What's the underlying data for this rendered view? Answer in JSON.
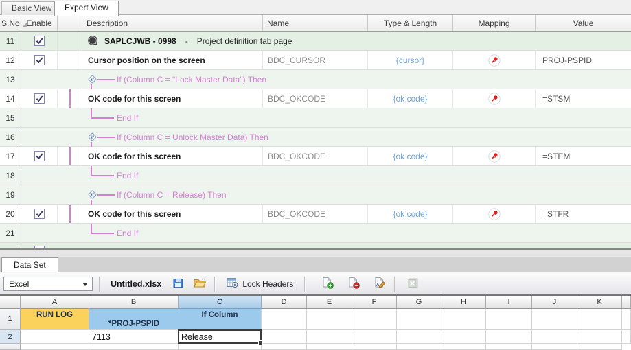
{
  "view_tabs": [
    {
      "label": "Basic View",
      "active": false
    },
    {
      "label": "Expert View",
      "active": true
    }
  ],
  "script_table": {
    "headers": [
      "S.No",
      "Enable",
      "",
      "Description",
      "Name",
      "Type & Length",
      "Mapping",
      "Value"
    ],
    "rows": [
      {
        "sno": "11",
        "kind": "screen",
        "enabled": true,
        "program": "SAPLCJWB - 0998",
        "separator": "-",
        "description": "Project definition tab page"
      },
      {
        "sno": "12",
        "kind": "field",
        "enabled": true,
        "in_branch": false,
        "description": "Cursor position on the screen",
        "name": "BDC_CURSOR",
        "type_length": "{cursor}",
        "mapping": "mapped",
        "value": "PROJ-PSPID"
      },
      {
        "sno": "13",
        "kind": "if",
        "text": "If (Column C = \"Lock Master Data\") Then"
      },
      {
        "sno": "14",
        "kind": "field",
        "enabled": true,
        "in_branch": true,
        "description": "OK code for this screen",
        "name": "BDC_OKCODE",
        "type_length": "{ok code}",
        "mapping": "mapped",
        "value": "=STSM"
      },
      {
        "sno": "15",
        "kind": "endif",
        "text": "End If"
      },
      {
        "sno": "16",
        "kind": "if",
        "text": "If (Column C = Unlock Master Data) Then"
      },
      {
        "sno": "17",
        "kind": "field",
        "enabled": true,
        "in_branch": true,
        "description": "OK code for this screen",
        "name": "BDC_OKCODE",
        "type_length": "{ok code}",
        "mapping": "mapped",
        "value": "=STEM"
      },
      {
        "sno": "18",
        "kind": "endif",
        "text": "End If"
      },
      {
        "sno": "19",
        "kind": "if",
        "text": "If (Column C = Release) Then"
      },
      {
        "sno": "20",
        "kind": "field",
        "enabled": true,
        "in_branch": true,
        "description": "OK code for this screen",
        "name": "BDC_OKCODE",
        "type_length": "{ok code}",
        "mapping": "mapped",
        "value": "=STFR"
      },
      {
        "sno": "21",
        "kind": "endif",
        "text": "End If"
      },
      {
        "sno": "",
        "kind": "screen_partial",
        "enabled": true
      }
    ]
  },
  "dataset": {
    "tab_label": "Data Set",
    "toolbar": {
      "source_type": "Excel",
      "file_name": "Untitled.xlsx",
      "lock_headers_label": "Lock Headers"
    },
    "spreadsheet": {
      "column_letters": [
        "A",
        "B",
        "C",
        "D",
        "E",
        "F",
        "G",
        "H",
        "I",
        "J",
        "K"
      ],
      "selected_column": "C",
      "selected_row": "2",
      "rows": [
        {
          "num": "1",
          "cells": {
            "A": "RUN LOG",
            "B": "*PROJ-PSPID",
            "C": "If Column"
          }
        },
        {
          "num": "2",
          "cells": {
            "B": "7113",
            "C": "Release"
          }
        }
      ]
    }
  },
  "colors": {
    "screen_row_bg": "#e5f0e5",
    "logic_row_bg": "#eef5ee",
    "if_line": "#d47fd4",
    "link_blue": "#6fa8dc",
    "header_yellow": "#fbd25c",
    "header_blue": "#9ccaec",
    "selection_border": "#3a3a3a",
    "mapping_pin_red": "#e02020"
  }
}
